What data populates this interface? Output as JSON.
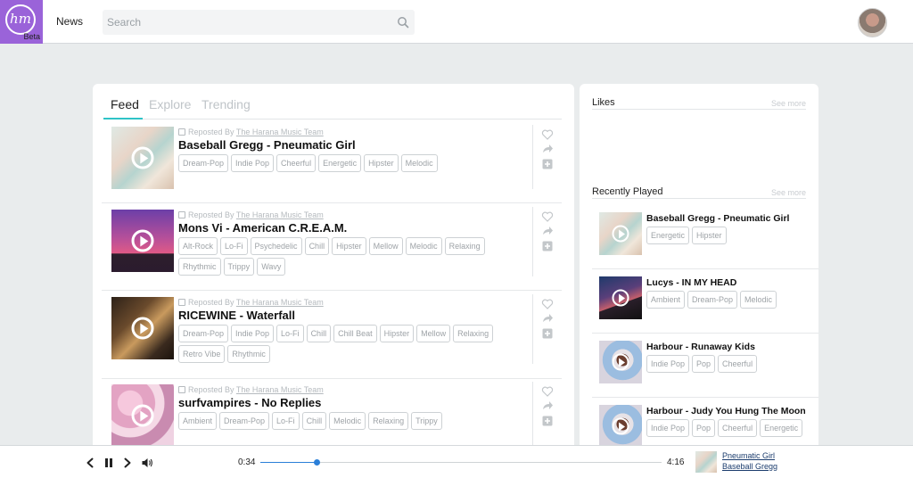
{
  "header": {
    "logo_text": "hm",
    "logo_badge": "Beta",
    "nav_news": "News",
    "search_placeholder": "Search"
  },
  "feed": {
    "tabs": [
      {
        "label": "Feed",
        "active": true
      },
      {
        "label": "Explore",
        "active": false
      },
      {
        "label": "Trending",
        "active": false
      }
    ],
    "items": [
      {
        "repost_prefix": "Reposted By",
        "repost_by": "The Harana Music Team",
        "title": "Baseball Gregg - Pneumatic Girl",
        "tags": [
          "Dream-Pop",
          "Indie Pop",
          "Cheerful",
          "Energetic",
          "Hipster",
          "Melodic"
        ]
      },
      {
        "repost_prefix": "Reposted By",
        "repost_by": "The Harana Music Team",
        "title": "Mons Vi - American C.R.E.A.M.",
        "tags": [
          "Alt-Rock",
          "Lo-Fi",
          "Psychedelic",
          "Chill",
          "Hipster",
          "Mellow",
          "Melodic",
          "Relaxing",
          "Rhythmic",
          "Trippy",
          "Wavy"
        ]
      },
      {
        "repost_prefix": "Reposted By",
        "repost_by": "The Harana Music Team",
        "title": "RICEWINE - Waterfall",
        "tags": [
          "Dream-Pop",
          "Indie Pop",
          "Lo-Fi",
          "Chill",
          "Chill Beat",
          "Hipster",
          "Mellow",
          "Relaxing",
          "Retro Vibe",
          "Rhythmic"
        ]
      },
      {
        "repost_prefix": "Reposted By",
        "repost_by": "The Harana Music Team",
        "title": "surfvampires - No Replies",
        "tags": [
          "Ambient",
          "Dream-Pop",
          "Lo-Fi",
          "Chill",
          "Melodic",
          "Relaxing",
          "Trippy"
        ]
      }
    ]
  },
  "sidebar": {
    "likes_heading": "Likes",
    "likes_see_more": "See more",
    "recent_heading": "Recently Played",
    "recent_see_more": "See more",
    "recent": [
      {
        "title": "Baseball Gregg - Pneumatic Girl",
        "tags": [
          "Energetic",
          "Hipster"
        ]
      },
      {
        "title": "Lucys - IN MY HEAD",
        "tags": [
          "Ambient",
          "Dream-Pop",
          "Melodic"
        ]
      },
      {
        "title": "Harbour - Runaway Kids",
        "tags": [
          "Indie Pop",
          "Pop",
          "Cheerful"
        ]
      },
      {
        "title": "Harbour - Judy You Hung The Moon",
        "tags": [
          "Indie Pop",
          "Pop",
          "Cheerful",
          "Energetic"
        ]
      }
    ]
  },
  "player": {
    "elapsed": "0:34",
    "duration": "4:16",
    "progress_fraction": 0.14,
    "now_playing_title": "Pneumatic Girl",
    "now_playing_artist": "Baseball Gregg"
  },
  "colors": {
    "brand": "#9a63d9",
    "tab_accent": "#2ec3c7",
    "progress": "#2b7fd8"
  },
  "icons": [
    "search-icon",
    "heart-icon",
    "share-icon",
    "add-icon",
    "play-icon",
    "previous-icon",
    "pause-icon",
    "next-icon",
    "volume-icon",
    "repost-icon"
  ]
}
